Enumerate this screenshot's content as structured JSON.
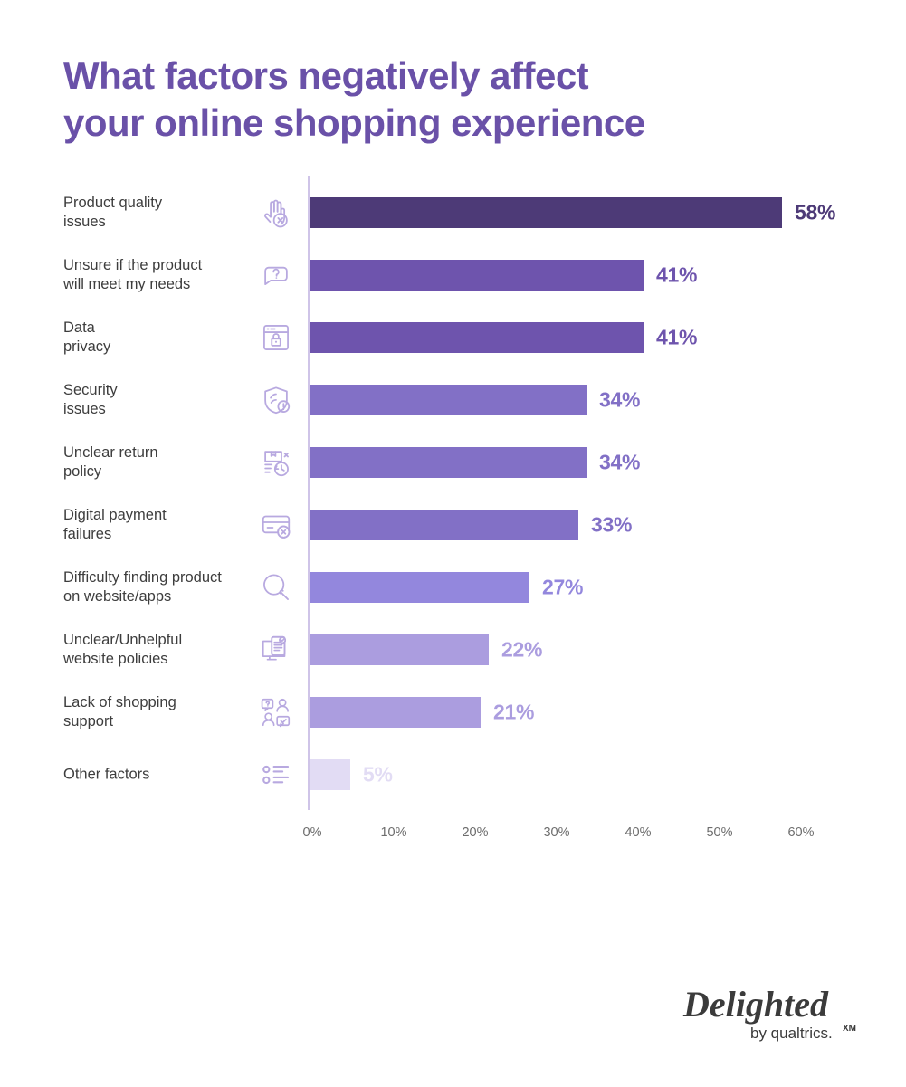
{
  "title": "What factors negatively affect\nyour online shopping experience",
  "title_color": "#6a51a8",
  "logo": {
    "wordmark": "Delighted",
    "tagline": "by qualtrics.",
    "tagline_suffix": "XM"
  },
  "axis": {
    "ticks": [
      "0%",
      "10%",
      "20%",
      "30%",
      "40%",
      "50%",
      "60%"
    ],
    "tick_values": [
      0,
      10,
      20,
      30,
      40,
      50,
      60
    ],
    "line_color": "#cfc4e8",
    "label_color": "#6d6d6d"
  },
  "chart_data": {
    "type": "bar",
    "orientation": "horizontal",
    "title": "What factors negatively affect your online shopping experience",
    "xlabel": "",
    "ylabel": "",
    "xlim": [
      0,
      60
    ],
    "grid": false,
    "legend": "none",
    "value_suffix": "%",
    "categories": [
      "Product quality issues",
      "Unsure if the product will meet my needs",
      "Data privacy",
      "Security issues",
      "Unclear return policy",
      "Digital payment failures",
      "Difficulty finding product on website/apps",
      "Unclear/Unhelpful website policies",
      "Lack of shopping support",
      "Other factors"
    ],
    "values": [
      58,
      41,
      41,
      34,
      34,
      33,
      27,
      22,
      21,
      5
    ],
    "value_labels": [
      "58%",
      "41%",
      "41%",
      "34%",
      "34%",
      "33%",
      "27%",
      "22%",
      "21%",
      "5%"
    ],
    "bar_colors": [
      "#4d3a77",
      "#6e54ad",
      "#6e54ad",
      "#8270c6",
      "#8270c6",
      "#8270c6",
      "#9387dd",
      "#ab9ddf",
      "#ab9ddf",
      "#e2dcf4"
    ]
  },
  "rows": [
    {
      "label": "Product quality\nissues",
      "icon": "hand-reject-icon",
      "value": 58,
      "value_label": "58%",
      "color": "#4d3a77"
    },
    {
      "label": "Unsure if the product\nwill meet my needs",
      "icon": "question-bubble-icon",
      "value": 41,
      "value_label": "41%",
      "color": "#6e54ad"
    },
    {
      "label": "Data\nprivacy",
      "icon": "browser-lock-icon",
      "value": 41,
      "value_label": "41%",
      "color": "#6e54ad"
    },
    {
      "label": "Security\nissues",
      "icon": "shield-alert-icon",
      "value": 34,
      "value_label": "34%",
      "color": "#8270c6"
    },
    {
      "label": "Unclear return\npolicy",
      "icon": "package-return-icon",
      "value": 34,
      "value_label": "34%",
      "color": "#8270c6"
    },
    {
      "label": "Digital payment\nfailures",
      "icon": "card-decline-icon",
      "value": 33,
      "value_label": "33%",
      "color": "#8270c6"
    },
    {
      "label": "Difficulty finding product\non website/apps",
      "icon": "magnifier-icon",
      "value": 27,
      "value_label": "27%",
      "color": "#9387dd"
    },
    {
      "label": "Unclear/Unhelpful\nwebsite policies",
      "icon": "monitor-document-icon",
      "value": 22,
      "value_label": "22%",
      "color": "#ab9ddf"
    },
    {
      "label": "Lack of shopping\nsupport",
      "icon": "support-agents-icon",
      "value": 21,
      "value_label": "21%",
      "color": "#ab9ddf"
    },
    {
      "label": "Other factors",
      "icon": "bullet-list-icon",
      "value": 5,
      "value_label": "5%",
      "color": "#e2dcf4"
    }
  ]
}
